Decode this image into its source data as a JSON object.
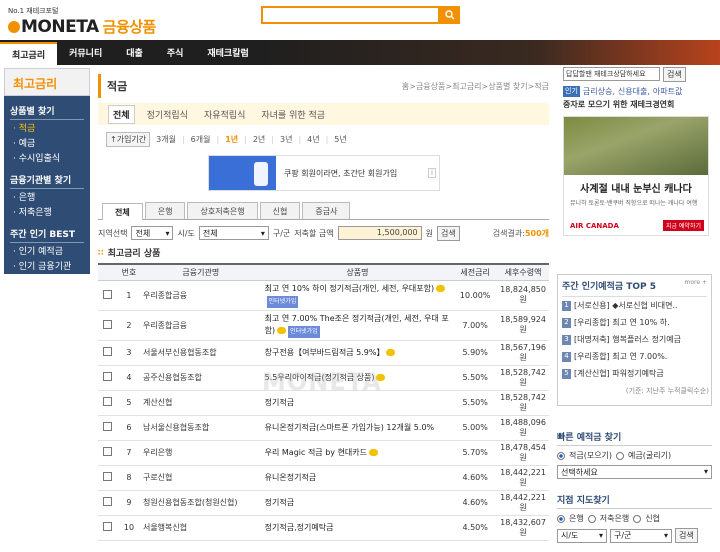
{
  "header": {
    "logo_sub": "No.1 재테크포털",
    "logo_main": "MONETA",
    "logo_fin": "금융상품",
    "search_icon": "search-icon"
  },
  "nav": [
    "최고금리",
    "커뮤니티",
    "대출",
    "주식",
    "재테크칼럼"
  ],
  "left": {
    "title": "최고금리",
    "sections": [
      {
        "title": "상품별 찾기",
        "items": [
          "적금",
          "예금",
          "수시입출식"
        ]
      },
      {
        "title": "금융기관별 찾기",
        "items": [
          "은행",
          "저축은행"
        ]
      },
      {
        "title": "주간 인기 BEST",
        "items": [
          "인기 예적금",
          "인기 금융기관"
        ]
      }
    ]
  },
  "main": {
    "title": "적금",
    "breadcrumb": "홈>금융상품>최고금리>상품별 찾기>적금",
    "subtabs": [
      "전체",
      "정기적립식",
      "자유적립식",
      "자녀를 위한 적금"
    ],
    "period_label": "가입기간",
    "periods": [
      "3개월",
      "6개월",
      "1년",
      "2년",
      "3년",
      "4년",
      "5년"
    ],
    "ad_text": "쿠팡 회원이라면, 초간단 회원가입",
    "bank_tabs": [
      "전체",
      "은행",
      "상호저축은행",
      "신협",
      "증금사"
    ],
    "filter": {
      "region_label": "지역선택",
      "region": "전체",
      "region_suffix": "시/도",
      "district": "전체",
      "district_suffix": "구/군",
      "amount_label": "저축할 금액",
      "amount": "1,500,000",
      "amount_unit": "원",
      "search_btn": "검색",
      "result_label": "검색결과:",
      "result_count": "500개"
    },
    "list_title": "최고금리 상품",
    "columns": [
      "번호",
      "금융기관명",
      "상품명",
      "세전금리",
      "세후수령액"
    ],
    "rows": [
      {
        "no": "1",
        "inst": "우리종합금융",
        "product": "최고 연 10% 하이 정기적금(개인, 세전, 우대포함)",
        "rate": "10.00%",
        "after": "18,824,850원",
        "coin": true,
        "badge": "인터넷가입"
      },
      {
        "no": "2",
        "inst": "우리종합금융",
        "product": "최고 연 7.00% The조은 정기적금(개인, 세전, 우대 포함)",
        "rate": "7.00%",
        "after": "18,589,924원",
        "coin": true,
        "badge": "인터넷가입"
      },
      {
        "no": "3",
        "inst": "서울서부신용협동조합",
        "product": "창구전용【여부바드림적금 5.9%】",
        "rate": "5.90%",
        "after": "18,567,196원",
        "coin": true,
        "badge": ""
      },
      {
        "no": "4",
        "inst": "공주신용협동조합",
        "product": "5.5우리아이적금(정기적금 상품)",
        "rate": "5.50%",
        "after": "18,528,742원",
        "coin": true,
        "badge": ""
      },
      {
        "no": "5",
        "inst": "계산신협",
        "product": "정기적금",
        "rate": "5.50%",
        "after": "18,528,742원",
        "coin": false,
        "badge": ""
      },
      {
        "no": "6",
        "inst": "남서울신용협동조합",
        "product": "유니온정기적금(스마트폰 가입가능) 12개월 5.0%",
        "rate": "5.00%",
        "after": "18,488,096원",
        "coin": false,
        "badge": ""
      },
      {
        "no": "7",
        "inst": "우리은행",
        "product": "우리 Magic 적금 by 현대카드",
        "rate": "5.70%",
        "after": "18,478,454원",
        "coin": true,
        "badge": ""
      },
      {
        "no": "8",
        "inst": "구로신협",
        "product": "유니온정기적금",
        "rate": "4.60%",
        "after": "18,442,221원",
        "coin": false,
        "badge": ""
      },
      {
        "no": "9",
        "inst": "청원신용협동조합(청원신협)",
        "product": "정기적금",
        "rate": "4.60%",
        "after": "18,442,221원",
        "coin": false,
        "badge": ""
      },
      {
        "no": "10",
        "inst": "서울행복신협",
        "product": "정기적금,정기예탁금",
        "rate": "4.50%",
        "after": "18,432,607원",
        "coin": false,
        "badge": ""
      }
    ],
    "watermark": "MONETA"
  },
  "right": {
    "search_value": "답답할땐 재테크상담하세요",
    "search_btn": "검색",
    "tag": "인기",
    "links": [
      "금리상승,",
      "신용대출,",
      "아파트값"
    ],
    "sub": "중자로 모으기 위한 재테크경연회",
    "ad_head": "사계절 내내 눈부신 캐나다",
    "ad_body": "뮤니히 토론토·밴쿠버 직항으로 떠나는 캐나다 여행",
    "ad_brand": "AIR CANADA",
    "ad_cta": "지금 예약하기",
    "top5_title": "주간 인기예적금 TOP 5",
    "more": "more",
    "top5": [
      {
        "n": "1",
        "text": "[서로신용] ◆서로신협 비대면.."
      },
      {
        "n": "2",
        "text": "[우리종합] 최고 연 10% 하."
      },
      {
        "n": "3",
        "text": "[대명저축] 행복플러스 정기예금"
      },
      {
        "n": "4",
        "text": "[우리종합] 최고 연 7.00%."
      },
      {
        "n": "5",
        "text": "[계산신협] 파워정기예탁금"
      }
    ],
    "top5_note": "(기준: 지난주 누적클릭수순)",
    "quick_title": "빠른 예적금 찾기",
    "quick_radios": [
      "적금(모으기)",
      "예금(굴리기)"
    ],
    "quick_select": "선택하세요",
    "branch_title": "지점 지도찾기",
    "branch_radios": [
      "은행",
      "저축은행",
      "신협"
    ],
    "branch_sel1": "시/도",
    "branch_sel2": "구/군",
    "branch_btn": "검색"
  }
}
